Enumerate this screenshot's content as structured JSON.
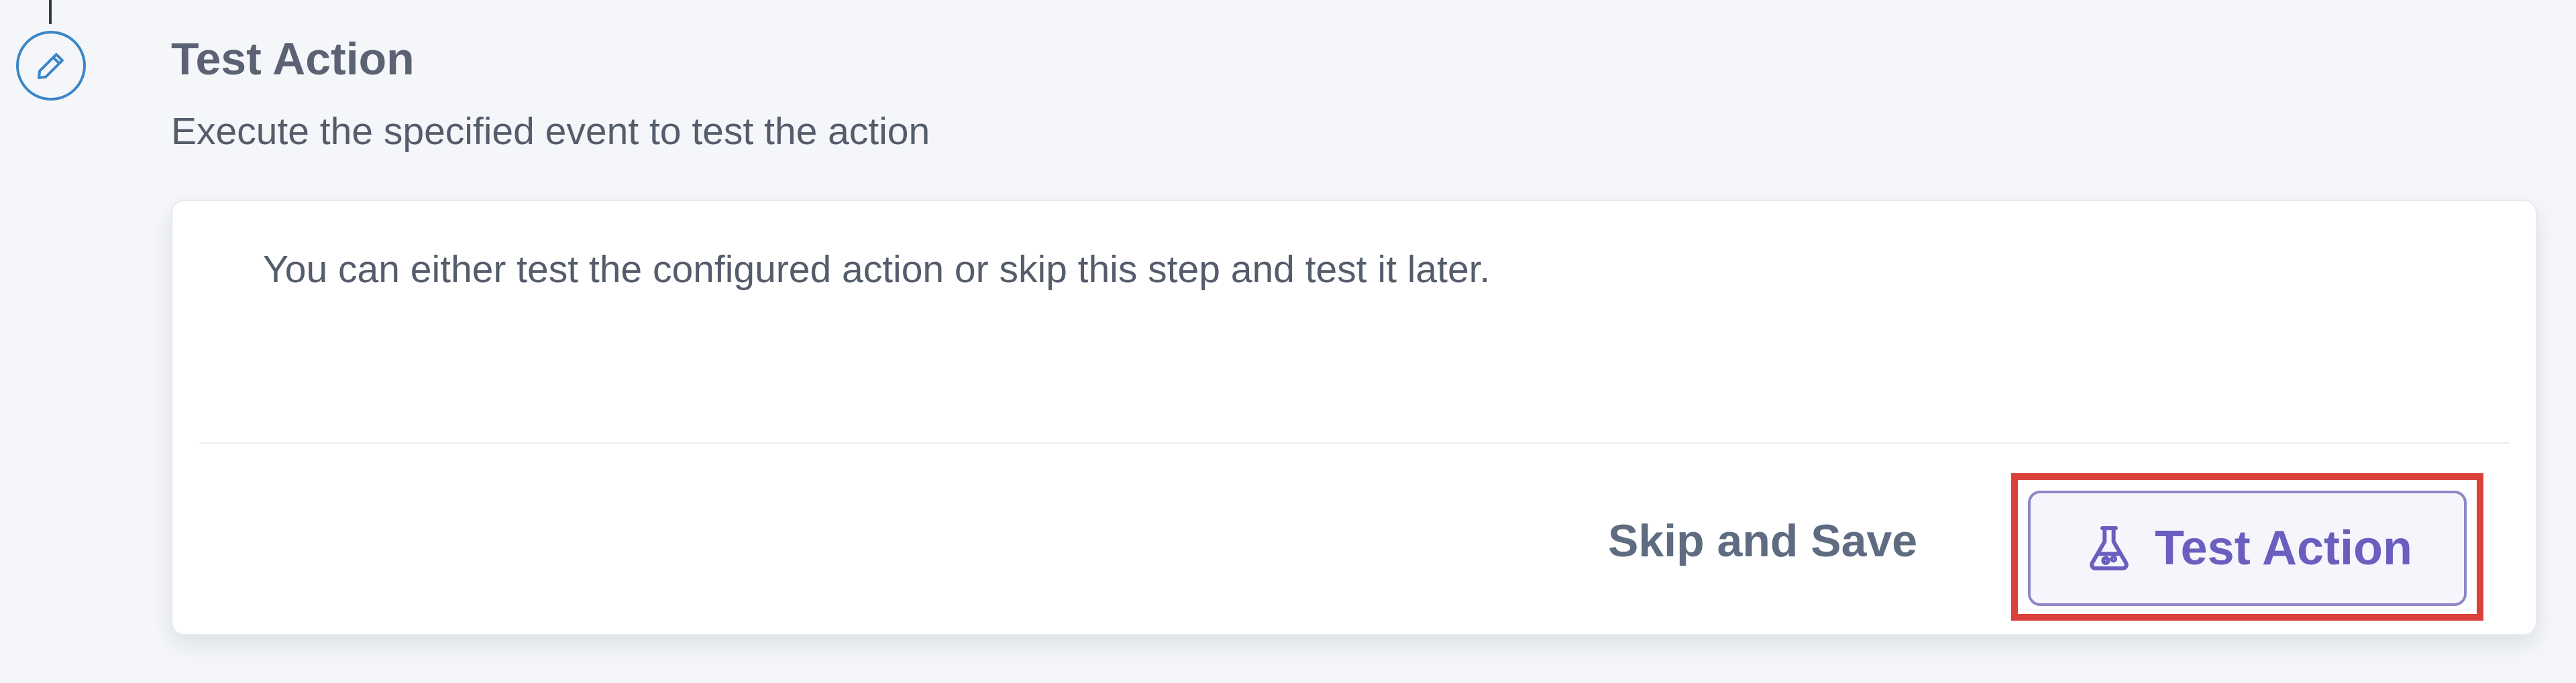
{
  "step": {
    "title": "Test Action",
    "subtitle": "Execute the specified event to test the action",
    "icon": "pencil-icon"
  },
  "card": {
    "message": "You can either test the configured action or skip this step and test it later."
  },
  "actions": {
    "skip_label": "Skip and Save",
    "test_label": "Test Action",
    "test_icon": "flask-icon"
  },
  "colors": {
    "accent": "#6a5fbf",
    "step_icon": "#3a86c8",
    "highlight": "#d9403a"
  }
}
